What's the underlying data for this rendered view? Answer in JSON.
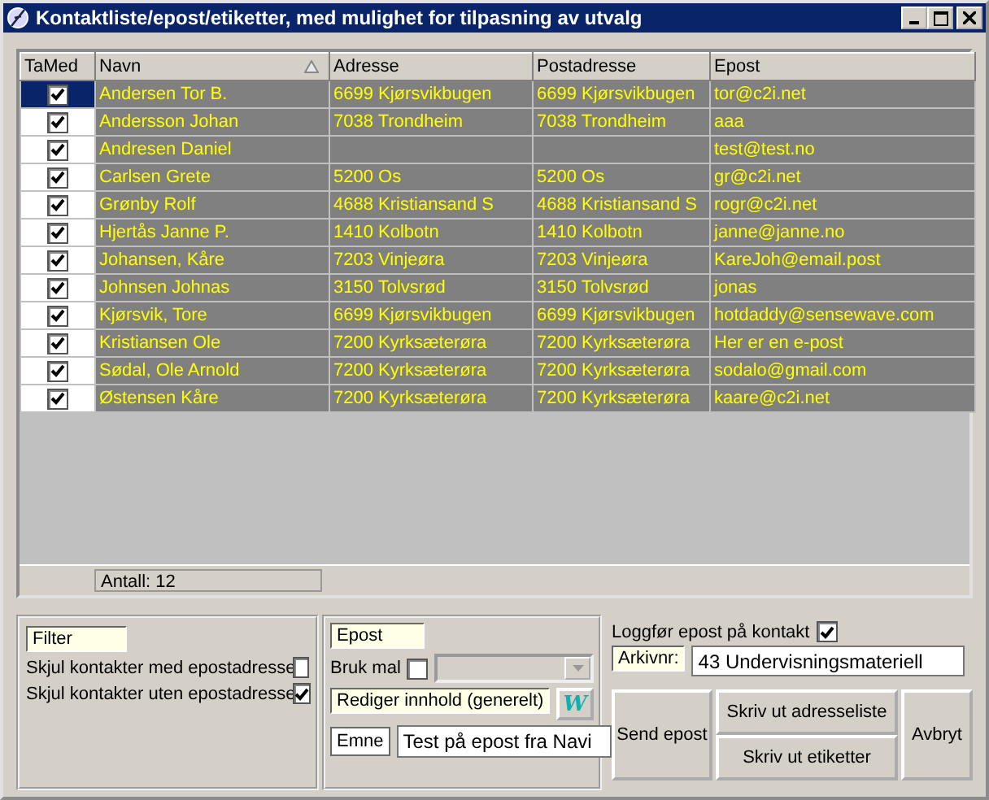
{
  "window": {
    "title": "Kontaktliste/epost/etiketter, med mulighet for tilpasning av utvalg"
  },
  "table": {
    "columns": [
      {
        "label": "TaMed",
        "sorted": false
      },
      {
        "label": "Navn",
        "sorted": true
      },
      {
        "label": "Adresse",
        "sorted": false
      },
      {
        "label": "Postadresse",
        "sorted": false
      },
      {
        "label": "Epost",
        "sorted": false
      }
    ],
    "rows": [
      {
        "checked": true,
        "selected": true,
        "navn": "Andersen Tor B.",
        "adresse": "6699 Kjørsvikbugen",
        "postadresse": "6699 Kjørsvikbugen",
        "epost": "tor@c2i.net"
      },
      {
        "checked": true,
        "selected": false,
        "navn": "Andersson Johan",
        "adresse": "7038 Trondheim",
        "postadresse": "7038 Trondheim",
        "epost": "aaa"
      },
      {
        "checked": true,
        "selected": false,
        "navn": "Andresen Daniel",
        "epost": "test@test.no"
      },
      {
        "checked": true,
        "selected": false,
        "navn": "Carlsen Grete",
        "adresse": "5200 Os",
        "postadresse": "5200 Os",
        "epost": "gr@c2i.net"
      },
      {
        "checked": true,
        "selected": false,
        "navn": "Grønby Rolf",
        "adresse": "4688 Kristiansand S",
        "postadresse": "4688 Kristiansand S",
        "epost": "rogr@c2i.net"
      },
      {
        "checked": true,
        "selected": false,
        "navn": "Hjertås Janne P.",
        "adresse": "1410 Kolbotn",
        "postadresse": "1410 Kolbotn",
        "epost": "janne@janne.no"
      },
      {
        "checked": true,
        "selected": false,
        "navn": "Johansen, Kåre",
        "adresse": "7203 Vinjeøra",
        "postadresse": "7203 Vinjeøra",
        "epost": "KareJoh@email.post"
      },
      {
        "checked": true,
        "selected": false,
        "navn": "Johnsen Johnas",
        "adresse": "3150 Tolvsrød",
        "postadresse": "3150 Tolvsrød",
        "epost": "jonas"
      },
      {
        "checked": true,
        "selected": false,
        "navn": "Kjørsvik, Tore",
        "adresse": "6699 Kjørsvikbugen",
        "postadresse": "6699 Kjørsvikbugen",
        "epost": "hotdaddy@sensewave.com"
      },
      {
        "checked": true,
        "selected": false,
        "navn": "Kristiansen Ole",
        "adresse": "7200 Kyrksæterøra",
        "postadresse": "7200 Kyrksæterøra",
        "epost": "Her er en e-post"
      },
      {
        "checked": true,
        "selected": false,
        "navn": "Sødal, Ole Arnold",
        "adresse": "7200 Kyrksæterøra",
        "postadresse": "7200 Kyrksæterøra",
        "epost": "sodalo@gmail.com"
      },
      {
        "checked": true,
        "selected": false,
        "navn": "Østensen Kåre",
        "adresse": "7200 Kyrksæterøra",
        "postadresse": "7200 Kyrksæterøra",
        "epost": "kaare@c2i.net"
      }
    ],
    "count": "Antall: 12"
  },
  "filter": {
    "label": "Filter",
    "options": [
      {
        "label": "Skjul kontakter med epostadresse",
        "checked": false
      },
      {
        "label": "Skjul kontakter uten epostadresse",
        "checked": true
      }
    ]
  },
  "email": {
    "label": "Epost",
    "template": {
      "label": "Bruk mal",
      "checked": false
    },
    "edit_label": "Rediger innhold (generelt)",
    "word_button": "W",
    "subject_label": "Emne",
    "subject": "Test på epost fra Navi"
  },
  "log": {
    "label": "Loggfør epost på kontakt",
    "checked": true,
    "archive_label": "Arkivnr:",
    "archive": "43 Undervisningsmateriell"
  },
  "buttons": {
    "send": "Send epost",
    "print_list": "Skriv ut adresseliste",
    "print_labels": "Skriv ut etiketter",
    "cancel": "Avbryt"
  }
}
